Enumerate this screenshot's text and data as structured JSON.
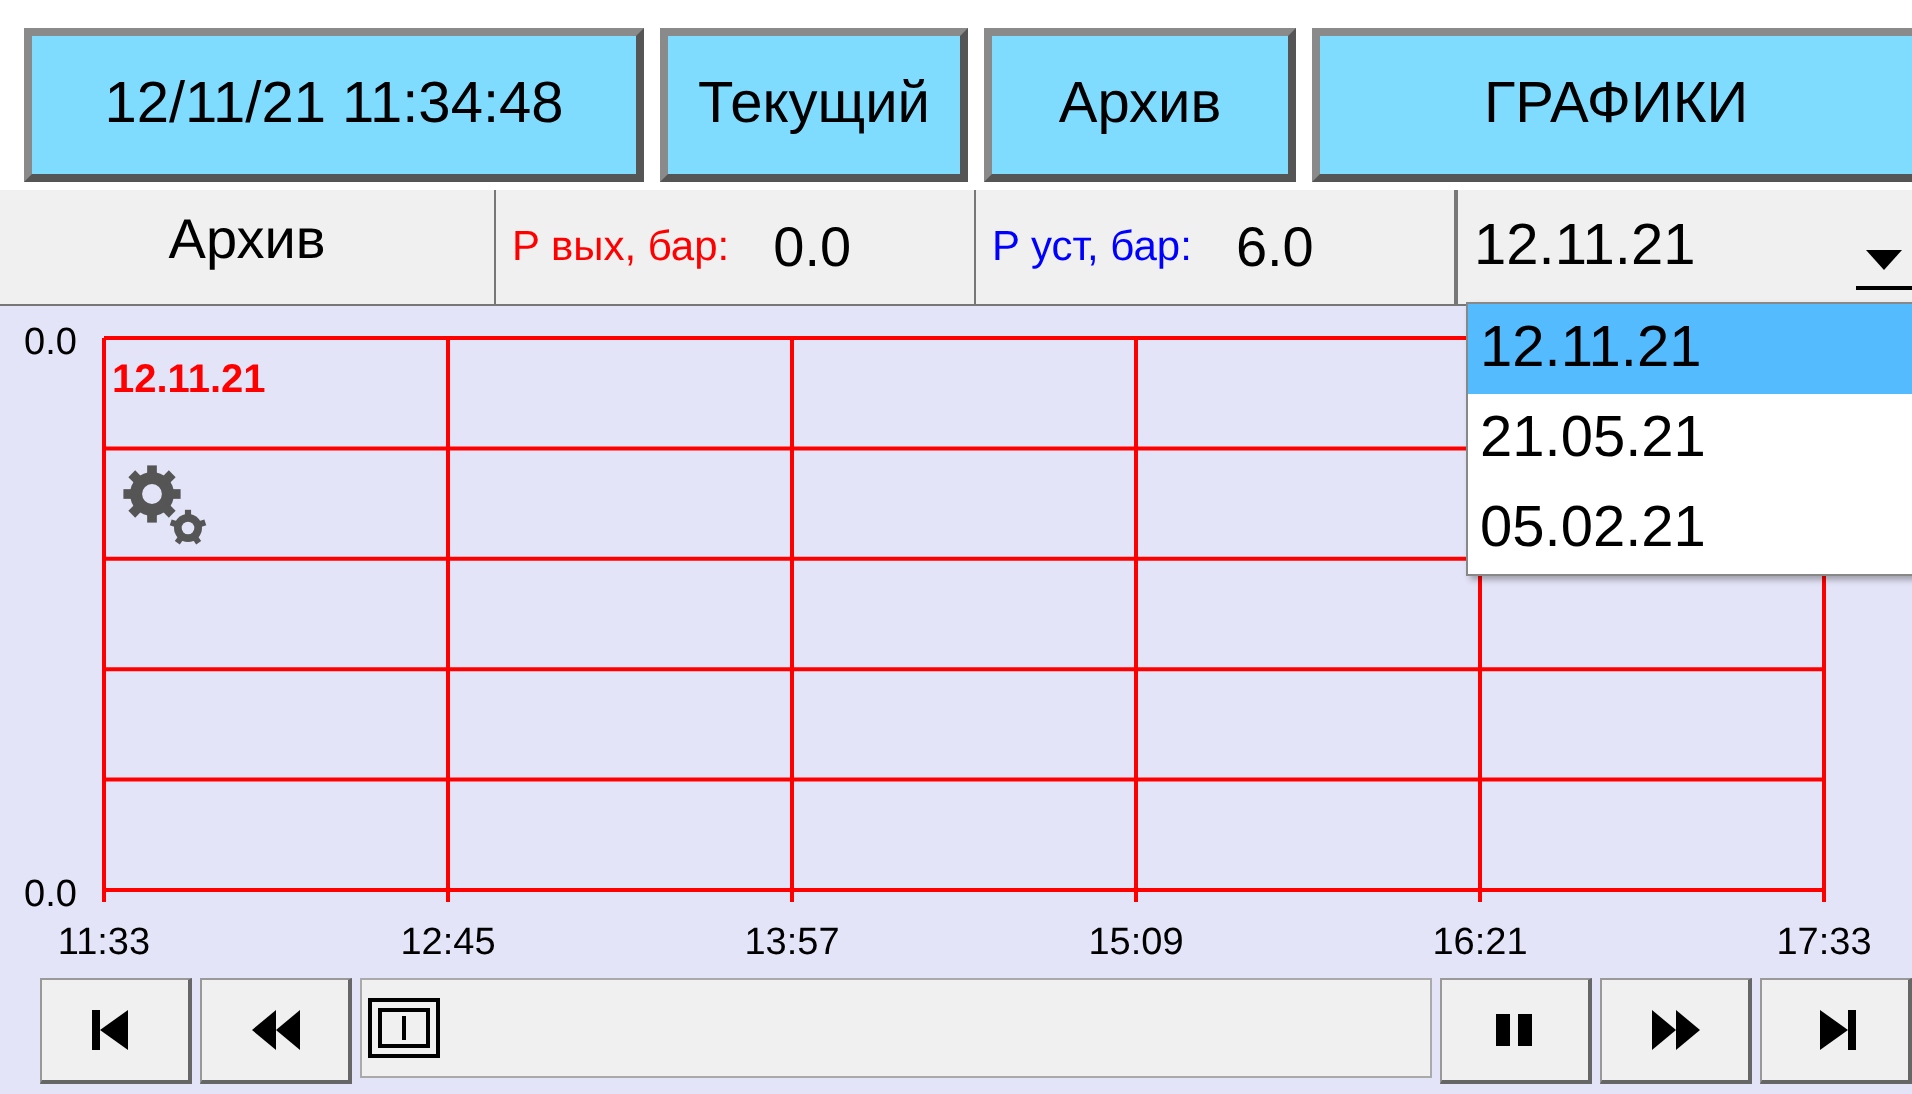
{
  "header": {
    "datetime": "12/11/21 11:34:48",
    "buttons": [
      {
        "label": "Текущий"
      },
      {
        "label": "Архив"
      },
      {
        "label": "ГРАФИКИ"
      }
    ]
  },
  "info_bar": {
    "mode": "Архив",
    "readings": [
      {
        "label": "P вых, бар:",
        "value": "0.0",
        "color": "#ff0000"
      },
      {
        "label": "P уст, бар:",
        "value": "6.0",
        "color": "#0000ff"
      }
    ]
  },
  "date_select": {
    "value": "12.11.21",
    "expanded": true,
    "options": [
      {
        "label": "12.11.21",
        "selected": true
      },
      {
        "label": "21.05.21",
        "selected": false
      },
      {
        "label": "05.02.21",
        "selected": false
      }
    ]
  },
  "chart": {
    "date_label": "12.11.21",
    "y_axis_labels": [
      "0.0",
      "0.0"
    ],
    "x_axis_labels": [
      "11:33",
      "12:45",
      "13:57",
      "15:09",
      "16:21",
      "17:33"
    ]
  },
  "playback": {
    "left": [
      {
        "kind": "first"
      },
      {
        "kind": "rewind"
      }
    ],
    "right": [
      {
        "kind": "pause"
      },
      {
        "kind": "forward"
      },
      {
        "kind": "last"
      }
    ]
  }
}
